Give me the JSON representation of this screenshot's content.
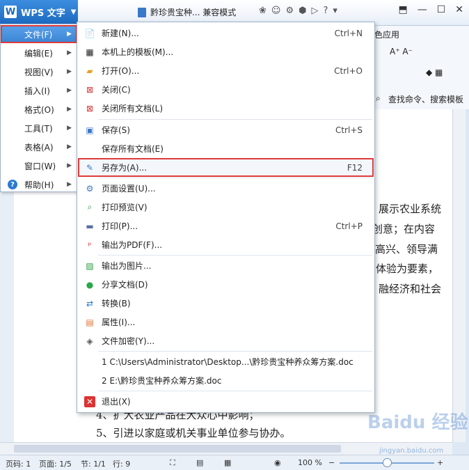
{
  "titlebar": {
    "app_name": "WPS 文字",
    "doc_title": "黔珍贵宝种... 兼容模式"
  },
  "ribbon": {
    "tab_partial": "色应用",
    "search_label": "查找命令、搜索模板"
  },
  "left_menu": [
    {
      "label": "文件(F)",
      "active": true
    },
    {
      "label": "编辑(E)"
    },
    {
      "label": "视图(V)"
    },
    {
      "label": "插入(I)"
    },
    {
      "label": "格式(O)"
    },
    {
      "label": "工具(T)"
    },
    {
      "label": "表格(A)"
    },
    {
      "label": "窗口(W)"
    },
    {
      "label": "帮助(H)"
    }
  ],
  "file_menu": {
    "items": [
      {
        "label": "新建(N)...",
        "shortcut": "Ctrl+N",
        "icon": "new-doc-icon"
      },
      {
        "label": "本机上的模板(M)...",
        "shortcut": "",
        "icon": "template-icon"
      },
      {
        "label": "打开(O)...",
        "shortcut": "Ctrl+O",
        "icon": "open-folder-icon"
      },
      {
        "label": "关闭(C)",
        "shortcut": "",
        "icon": "close-doc-icon"
      },
      {
        "label": "关闭所有文档(L)",
        "shortcut": "",
        "icon": "close-all-icon"
      },
      {
        "label": "保存(S)",
        "shortcut": "Ctrl+S",
        "icon": "save-icon"
      },
      {
        "label": "保存所有文档(E)",
        "shortcut": "",
        "icon": ""
      },
      {
        "label": "另存为(A)...",
        "shortcut": "F12",
        "icon": "save-as-icon"
      },
      {
        "label": "页面设置(U)...",
        "shortcut": "",
        "icon": "page-setup-icon"
      },
      {
        "label": "打印预览(V)",
        "shortcut": "",
        "icon": "print-preview-icon"
      },
      {
        "label": "打印(P)...",
        "shortcut": "Ctrl+P",
        "icon": "print-icon"
      },
      {
        "label": "输出为PDF(F)...",
        "shortcut": "",
        "icon": "pdf-icon"
      },
      {
        "label": "输出为图片...",
        "shortcut": "",
        "icon": "image-export-icon"
      },
      {
        "label": "分享文档(D)",
        "shortcut": "",
        "icon": "share-icon"
      },
      {
        "label": "转换(B)",
        "shortcut": "",
        "icon": "convert-icon"
      },
      {
        "label": "属性(I)...",
        "shortcut": "",
        "icon": "properties-icon"
      },
      {
        "label": "文件加密(Y)...",
        "shortcut": "",
        "icon": "encrypt-icon"
      }
    ],
    "recent": [
      "1 C:\\Users\\Administrator\\Desktop...\\黔珍贵宝种养众筹方案.doc",
      "2 E:\\黔珍贵宝种养众筹方案.doc"
    ],
    "exit": {
      "label": "退出(X)",
      "icon": "exit-icon"
    }
  },
  "document": {
    "lines": [
      "展示农业系统",
      "业创意；在内容",
      "民高兴、领导满",
      "体验为要素，",
      "融经济和社会",
      "4、扩大农业产品在大众心中影响；",
      "5、引进以家庭或机关事业单位参与协办。"
    ]
  },
  "status": {
    "page_num": "页码: 1",
    "pages": "页面: 1/5",
    "section": "节: 1/1",
    "row": "行: 9",
    "zoom": "100 %",
    "zoom_level": 0.6
  },
  "watermark": {
    "text": "Baidu 经验",
    "url": "jingyan.baidu.com"
  }
}
